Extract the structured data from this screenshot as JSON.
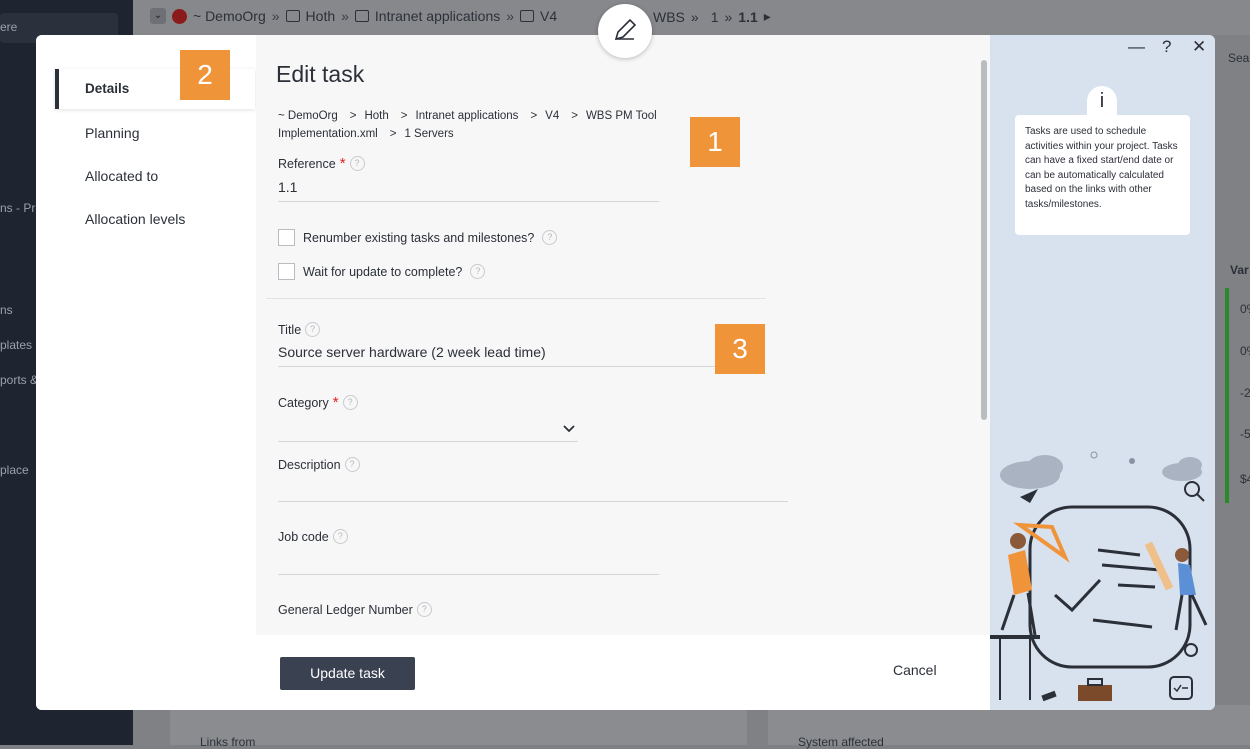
{
  "background": {
    "breadcrumbs": [
      "~ DemoOrg",
      "Hoth",
      "Intranet applications",
      "V4",
      "WBS",
      "1",
      "1.1"
    ],
    "sidebar_fragments": [
      "ere",
      "ns - Pro",
      "ns",
      "plates",
      "ports &",
      "place"
    ],
    "right_fragments": [
      "Sea",
      "Var",
      "0%",
      "0%",
      "-2",
      "-5",
      "$4"
    ],
    "bottom_labels": [
      "Links from",
      "System affected"
    ]
  },
  "modal": {
    "nav": [
      "Details",
      "Planning",
      "Allocated to",
      "Allocation levels"
    ],
    "title": "Edit task",
    "breadcrumb": {
      "items": [
        "~ DemoOrg",
        "Hoth",
        "Intranet applications",
        "V4",
        "WBS PM Tool Implementation.xml",
        "1 Servers"
      ]
    },
    "fields": {
      "reference_label": "Reference",
      "reference_value": "1.1",
      "renumber_label": "Renumber existing tasks and milestones?",
      "wait_label": "Wait for update to complete?",
      "title_label": "Title",
      "title_value": "Source server hardware (2 week lead time)",
      "category_label": "Category",
      "description_label": "Description",
      "job_code_label": "Job code",
      "gl_label": "General Ledger Number"
    },
    "buttons": {
      "update": "Update task",
      "cancel": "Cancel"
    },
    "info_text": "Tasks are used to schedule activities within your project. Tasks can have a fixed start/end date or can be automatically calculated based on the links with other tasks/milestones.",
    "info_icon": "i",
    "window_controls": {
      "minimize": "—",
      "help": "?",
      "close": "✕"
    },
    "help_icon": "?",
    "required_marker": "*"
  },
  "annotations": [
    "1",
    "2",
    "3"
  ],
  "colors": {
    "accent_orange": "#f0943a",
    "button_dark": "#3a4151",
    "required": "#dd2222",
    "side_panel": "#d8e1ee"
  }
}
